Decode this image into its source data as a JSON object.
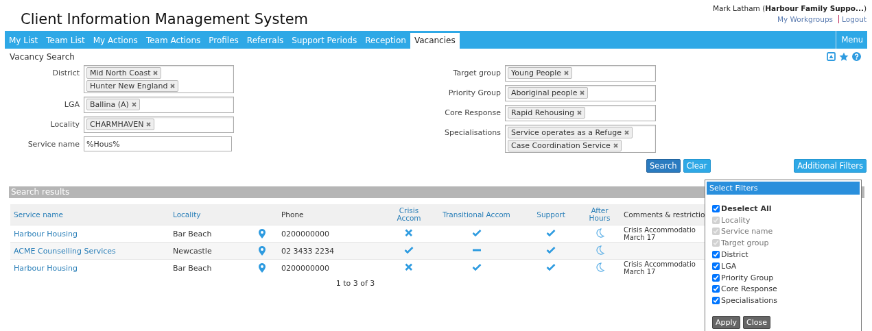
{
  "app_title": "Client Information Management System",
  "user": {
    "line": "Mark Latham (**Harbour Family Suppo...**)",
    "links": [
      "My Workgroups",
      "Logout"
    ]
  },
  "tabs": [
    {
      "label": "My List",
      "selected": false
    },
    {
      "label": "Team List",
      "selected": false
    },
    {
      "label": "My Actions",
      "selected": false
    },
    {
      "label": "Team Actions",
      "selected": false
    },
    {
      "label": "Profiles",
      "selected": false
    },
    {
      "label": "Referrals",
      "selected": false
    },
    {
      "label": "Support Periods",
      "selected": false
    },
    {
      "label": "Reception",
      "selected": false
    },
    {
      "label": "Vacancies",
      "selected": true
    }
  ],
  "menu_button": "Menu",
  "section_title": "Vacancy Search",
  "left_fields": [
    {
      "label": "District",
      "tags": [
        "Mid North Coast",
        "Hunter New England"
      ]
    },
    {
      "label": "LGA",
      "tags": [
        "Ballina (A)"
      ]
    },
    {
      "label": "Locality",
      "tags": [
        "CHARMHAVEN"
      ]
    },
    {
      "label": "Service name",
      "value": "%Hous%"
    }
  ],
  "right_fields": [
    {
      "label": "Target group",
      "tags": [
        "Young People"
      ]
    },
    {
      "label": "Priority Group",
      "tags": [
        "Aboriginal people"
      ]
    },
    {
      "label": "Core Response",
      "tags": [
        "Rapid Rehousing"
      ]
    },
    {
      "label": "Specialisations",
      "tags": [
        "Service operates as a Refuge",
        "Case Coordination Service"
      ]
    }
  ],
  "buttons": {
    "search": "Search",
    "clear": "Clear",
    "additional": "Additional Filters"
  },
  "results": {
    "title": "Search results",
    "columns": [
      "Service name",
      "Locality",
      "Phone",
      "Crisis Accom",
      "Transitional Accom",
      "Support",
      "After Hours",
      "Comments & restrictio"
    ],
    "rows": [
      {
        "service": "Harbour Housing",
        "locality": "Bar Beach",
        "phone": "0200000000",
        "status": [
          {
            "kind": "cross"
          },
          {
            "kind": "tick"
          },
          {
            "kind": "tick"
          }
        ],
        "after_hours": true,
        "comments": [
          "Crisis Accommodatio",
          "March 17"
        ]
      },
      {
        "service": "ACME Counselling Services",
        "locality": "Newcastle",
        "phone": "02 3433 2234",
        "status": [
          {
            "kind": "tick"
          },
          {
            "kind": "dash"
          },
          {
            "kind": "tick"
          }
        ],
        "after_hours": true,
        "comments": []
      },
      {
        "service": "Harbour Housing",
        "locality": "Bar Beach",
        "phone": "0200000000",
        "status": [
          {
            "kind": "cross"
          },
          {
            "kind": "tick"
          },
          {
            "kind": "tick"
          }
        ],
        "after_hours": true,
        "comments": [
          "Crisis Accommodatio",
          "March 17"
        ]
      }
    ],
    "pager": "1 to 3 of 3"
  },
  "filters_popup": {
    "title": "Select Filters",
    "items": [
      {
        "label": "Deselect All",
        "checked": true,
        "disabled": false,
        "bold": true
      },
      {
        "label": "Locality",
        "checked": true,
        "disabled": true,
        "bold": false
      },
      {
        "label": "Service name",
        "checked": true,
        "disabled": true,
        "bold": false
      },
      {
        "label": "Target group",
        "checked": true,
        "disabled": true,
        "bold": false
      },
      {
        "label": "District",
        "checked": true,
        "disabled": false,
        "bold": false
      },
      {
        "label": "LGA",
        "checked": true,
        "disabled": false,
        "bold": false
      },
      {
        "label": "Priority Group",
        "checked": true,
        "disabled": false,
        "bold": false
      },
      {
        "label": "Core Response",
        "checked": true,
        "disabled": false,
        "bold": false
      },
      {
        "label": "Specialisations",
        "checked": true,
        "disabled": false,
        "bold": false
      }
    ],
    "buttons": [
      "Apply",
      "Close"
    ]
  }
}
